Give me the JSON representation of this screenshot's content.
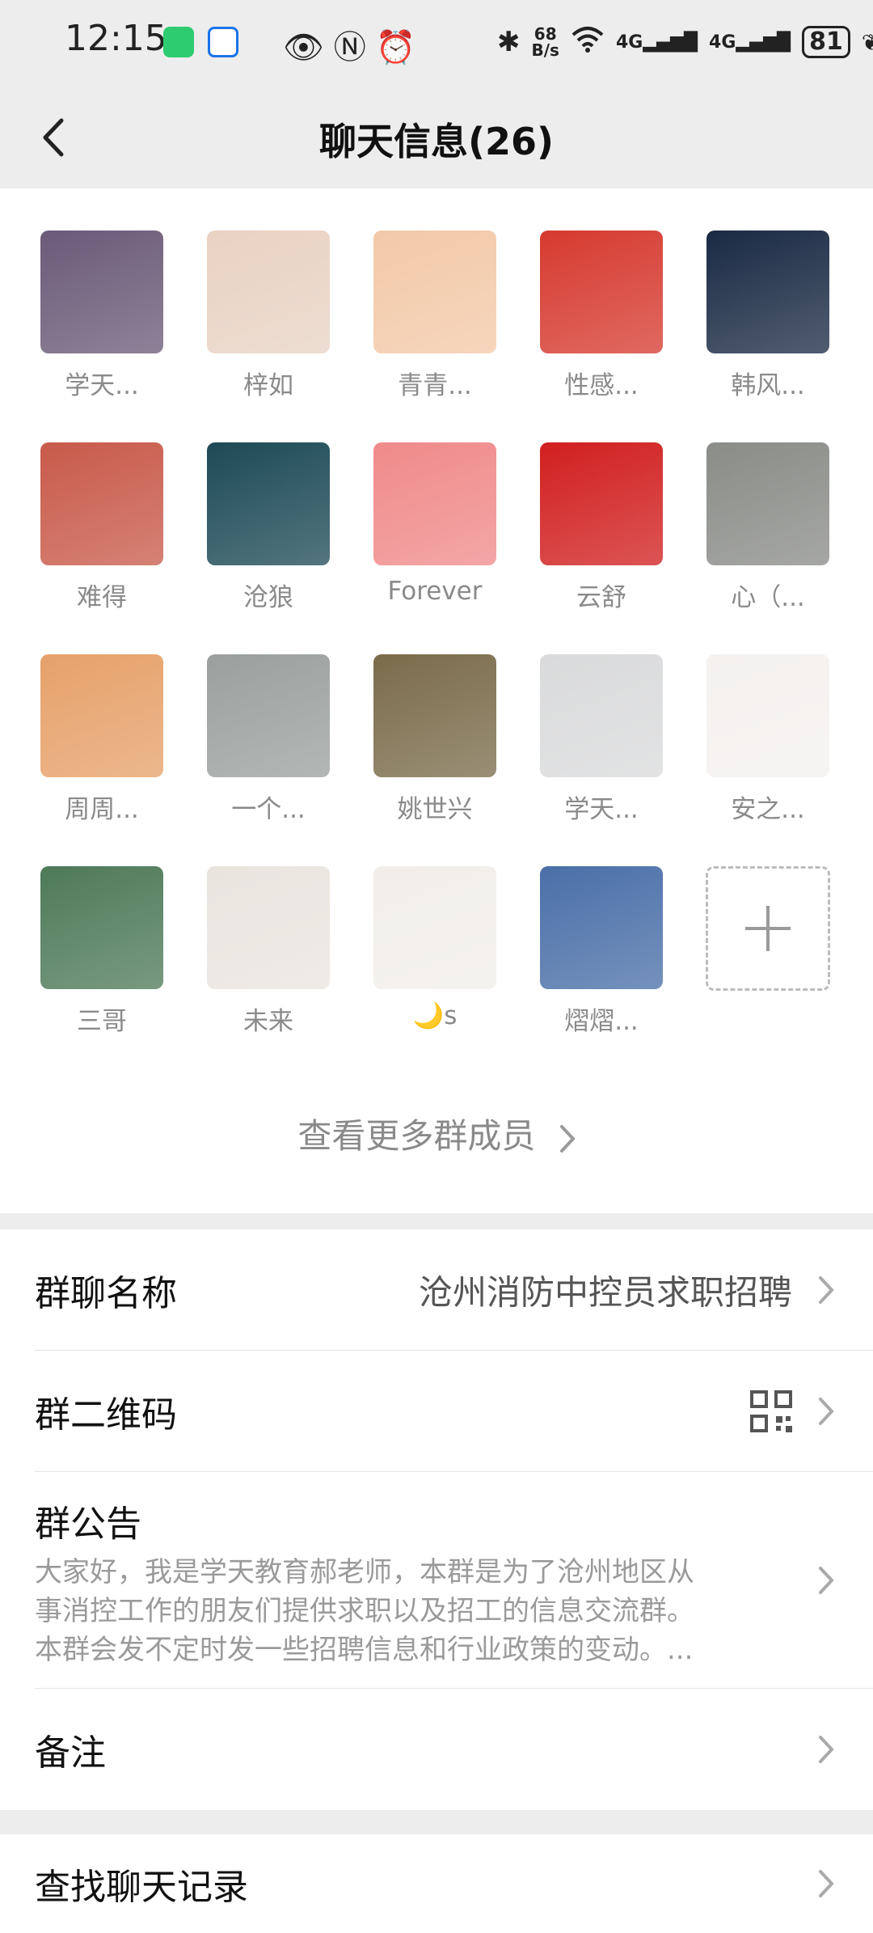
{
  "status_bar": {
    "time": "12:15",
    "net_speed_value": "68",
    "net_speed_unit": "B/s",
    "signal1": "4G",
    "signal2": "4G",
    "battery": "81"
  },
  "nav": {
    "title": "聊天信息(26)"
  },
  "members": [
    {
      "name": "学天...",
      "avatar_color": "#6b5a78"
    },
    {
      "name": "梓如",
      "avatar_color": "#e8d2c3"
    },
    {
      "name": "青青...",
      "avatar_color": "#f3c9a8"
    },
    {
      "name": "性感...",
      "avatar_color": "#d63a2f"
    },
    {
      "name": "韩风...",
      "avatar_color": "#1a2a44"
    },
    {
      "name": "难得",
      "avatar_color": "#c85a4a"
    },
    {
      "name": "沧狼",
      "avatar_color": "#1d4a56"
    },
    {
      "name": "Forever",
      "avatar_color": "#f08a8a"
    },
    {
      "name": "云舒",
      "avatar_color": "#d11f1f"
    },
    {
      "name": "心（...",
      "avatar_color": "#8a8c88"
    },
    {
      "name": "周周...",
      "avatar_color": "#e6a16a"
    },
    {
      "name": "一个...",
      "avatar_color": "#9ba09e"
    },
    {
      "name": "姚世兴",
      "avatar_color": "#7a6b4a"
    },
    {
      "name": "学天...",
      "avatar_color": "#d9dadb"
    },
    {
      "name": "安之...",
      "avatar_color": "#f4f1ef"
    },
    {
      "name": "三哥",
      "avatar_color": "#4e7a58"
    },
    {
      "name": "未来",
      "avatar_color": "#e9e4de"
    },
    {
      "name": "🌙s",
      "avatar_color": "#f1eeea"
    },
    {
      "name": "熠熠...",
      "avatar_color": "#4a6fa8"
    }
  ],
  "more_members_label": "查看更多群成员",
  "settings": {
    "group_name_label": "群聊名称",
    "group_name_value": "沧州消防中控员求职招聘",
    "qrcode_label": "群二维码",
    "notice_label": "群公告",
    "notice_lines": [
      "大家好，我是学天教育郝老师，本群是为了沧州地区从",
      "事消控工作的朋友们提供求职以及招工的信息交流群。",
      "本群会发不定时发一些招聘信息和行业政策的变动。..."
    ],
    "remark_label": "备注",
    "search_history_label": "查找聊天记录"
  }
}
